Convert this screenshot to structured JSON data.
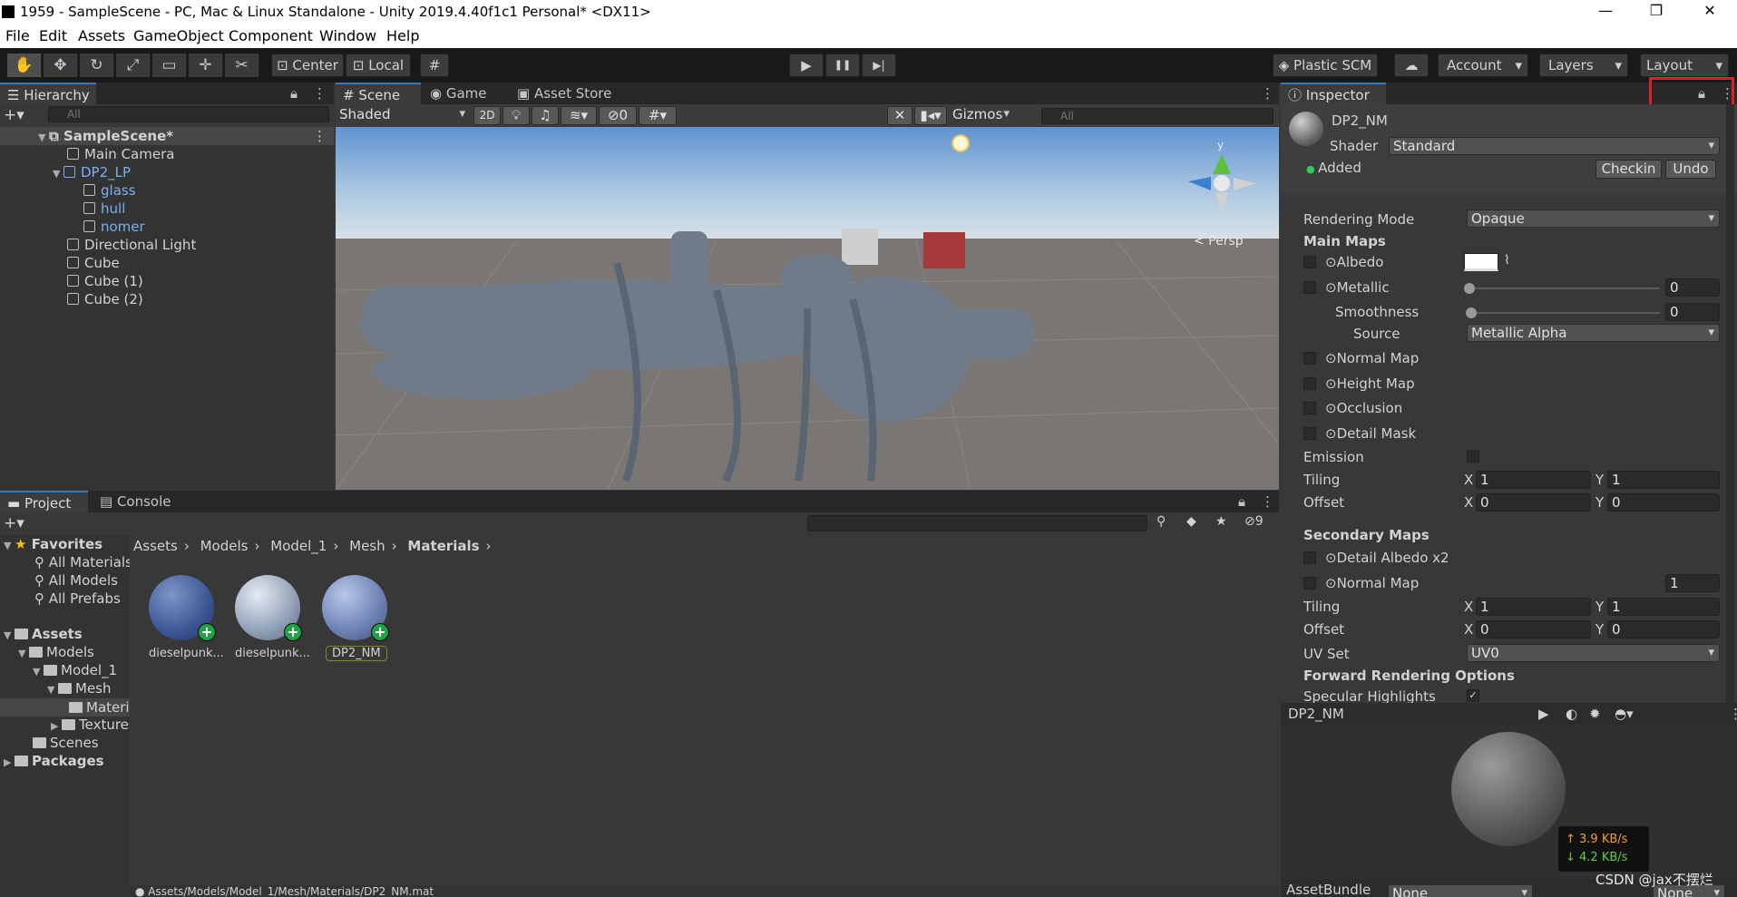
{
  "window": {
    "title": "1959 - SampleScene - PC, Mac & Linux Standalone - Unity 2019.4.40f1c1 Personal* <DX11>",
    "minimize": "—",
    "maximize": "❐",
    "close": "✕"
  },
  "menu": [
    "File",
    "Edit",
    "Assets",
    "GameObject",
    "Component",
    "Window",
    "Help"
  ],
  "toolbar": {
    "center": "Center",
    "local": "Local",
    "plastic": "Plastic SCM",
    "account": "Account",
    "layers": "Layers",
    "layout": "Layout",
    "play": "▶",
    "pause": "❚❚",
    "step": "▶|"
  },
  "hierarchy": {
    "tab": "Hierarchy",
    "search_placeholder": "All",
    "scene": "SampleScene*",
    "items": [
      "Main Camera",
      "DP2_LP",
      "glass",
      "hull",
      "nomer",
      "Directional Light",
      "Cube",
      "Cube (1)",
      "Cube (2)"
    ]
  },
  "scene_view": {
    "tabs": [
      "Scene",
      "Game",
      "Asset Store"
    ],
    "shading": "Shaded",
    "mode2d": "2D",
    "hidden_count": "0",
    "gizmos": "Gizmos",
    "search_placeholder": "All",
    "persp": "< Persp",
    "axis_y": "y"
  },
  "project": {
    "tabs": [
      "Project",
      "Console"
    ],
    "hidden_count": "9",
    "tree": {
      "favorites": "Favorites",
      "fav_items": [
        "All Materials",
        "All Models",
        "All Prefabs"
      ],
      "assets": "Assets",
      "models": "Models",
      "model1": "Model_1",
      "mesh": "Mesh",
      "materials": "Materials",
      "textures": "Textures",
      "scenes": "Scenes",
      "packages": "Packages"
    },
    "breadcrumb": [
      "Assets",
      "Models",
      "Model_1",
      "Mesh",
      "Materials"
    ],
    "files": [
      "dieselpunk...",
      "dieselpunk...",
      "DP2_NM"
    ],
    "status_path": "Assets/Models/Model_1/Mesh/Materials/DP2_NM.mat"
  },
  "inspector": {
    "tab": "Inspector",
    "material": "DP2_NM",
    "shader_label": "Shader",
    "shader": "Standard",
    "added": "Added",
    "checkin": "Checkin",
    "undo": "Undo",
    "rendering_mode_label": "Rendering Mode",
    "rendering_mode": "Opaque",
    "main_maps": "Main Maps",
    "albedo": "Albedo",
    "metallic": "Metallic",
    "metallic_val": "0",
    "smoothness": "Smoothness",
    "smoothness_val": "0",
    "source_label": "Source",
    "source": "Metallic Alpha",
    "normal_map": "Normal Map",
    "height_map": "Height Map",
    "occlusion": "Occlusion",
    "detail_mask": "Detail Mask",
    "emission": "Emission",
    "tiling": "Tiling",
    "offset": "Offset",
    "x": "X",
    "y": "Y",
    "tiling_x": "1",
    "tiling_y": "1",
    "offset_x": "0",
    "offset_y": "0",
    "secondary_maps": "Secondary Maps",
    "detail_albedo": "Detail Albedo x2",
    "normal_map2": "Normal Map",
    "normal_scale": "1",
    "tiling2_x": "1",
    "tiling2_y": "1",
    "offset2_x": "0",
    "offset2_y": "0",
    "uv_set_label": "UV Set",
    "uv_set": "UV0",
    "forward_opts": "Forward Rendering Options",
    "specular": "Specular Highlights",
    "preview_title": "DP2_NM",
    "assetbundle": "AssetBundle",
    "ab_none1": "None",
    "ab_none2": "None"
  },
  "net": {
    "up": "↑ 3.9 KB/s",
    "down": "↓ 4.2 KB/s"
  },
  "watermark": "CSDN @jax不摆烂"
}
